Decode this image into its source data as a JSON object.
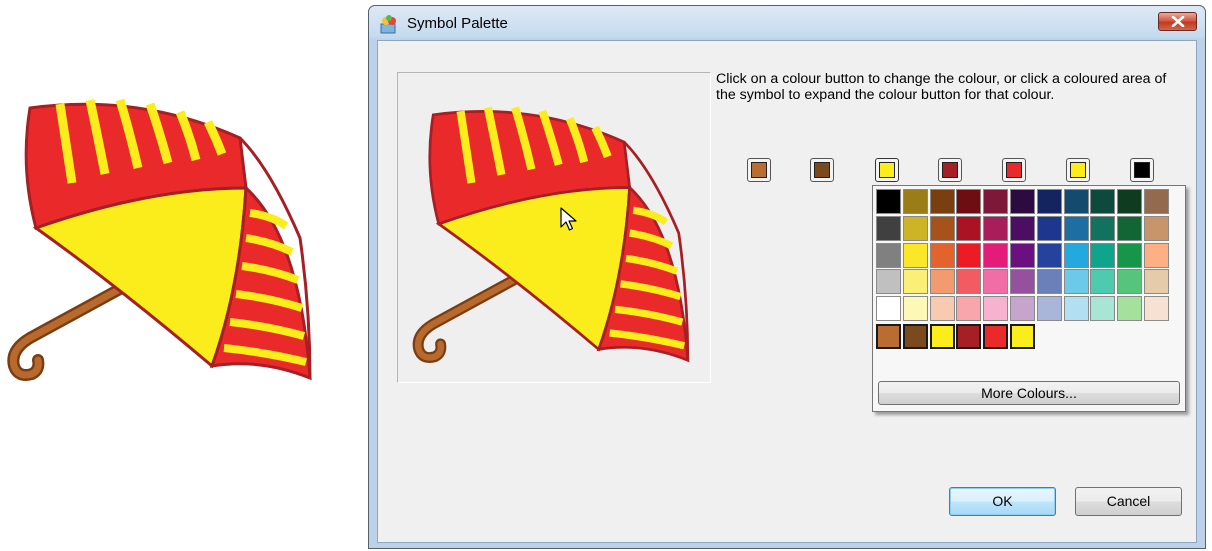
{
  "window": {
    "title": "Symbol Palette",
    "close_icon": "close-icon"
  },
  "instructions": "Click on a colour button to change the colour, or click a coloured area of the symbol to expand the colour button for that colour.",
  "symbol_colours": [
    {
      "name": "brown-light",
      "hex": "#b96d30"
    },
    {
      "name": "brown-dark",
      "hex": "#7a4a1e"
    },
    {
      "name": "yellow",
      "hex": "#fbed1c"
    },
    {
      "name": "dark-red",
      "hex": "#a51f24"
    },
    {
      "name": "red",
      "hex": "#ea2a2a"
    },
    {
      "name": "yellow-2",
      "hex": "#fbed1c"
    },
    {
      "name": "black",
      "hex": "#000000"
    }
  ],
  "expanded_swatch_index": 2,
  "palette": {
    "rows": [
      [
        "#000000",
        "#9b7d17",
        "#7a3f0f",
        "#6e0e13",
        "#7d1838",
        "#2d0a3f",
        "#13245f",
        "#134a6e",
        "#0d4a3d",
        "#0f3b20",
        "#946a4f"
      ],
      [
        "#404040",
        "#cdb326",
        "#a6521a",
        "#ab1322",
        "#a81d5a",
        "#4b0e62",
        "#1d368e",
        "#1c6ea3",
        "#11735d",
        "#126634",
        "#c8956b"
      ],
      [
        "#808080",
        "#fbe627",
        "#e4622b",
        "#ed1c24",
        "#e31c7a",
        "#6c0f80",
        "#25429c",
        "#23a8df",
        "#0ea58c",
        "#17954a",
        "#fdb084"
      ],
      [
        "#c0c0c0",
        "#fcef78",
        "#f29b71",
        "#f15b61",
        "#f06ea5",
        "#95519d",
        "#6b7fbb",
        "#6ccae8",
        "#4ecaae",
        "#57c47b",
        "#e6cbab"
      ],
      [
        "#ffffff",
        "#fef8b6",
        "#f8cbb1",
        "#f8a6ab",
        "#f6b2cf",
        "#c7a4cc",
        "#aab6d9",
        "#b1e0f2",
        "#a7e5d4",
        "#a3e19c",
        "#f7e1d2"
      ]
    ],
    "recent": [
      "#b96d30",
      "#7a4a1e",
      "#fbed1c",
      "#a51f24",
      "#ea2a2a",
      "#fbed1c"
    ],
    "more_label": "More Colours..."
  },
  "buttons": {
    "ok": "OK",
    "cancel": "Cancel"
  },
  "icons": {
    "title": "palette-icon",
    "cursor": "mouse-pointer-icon"
  }
}
